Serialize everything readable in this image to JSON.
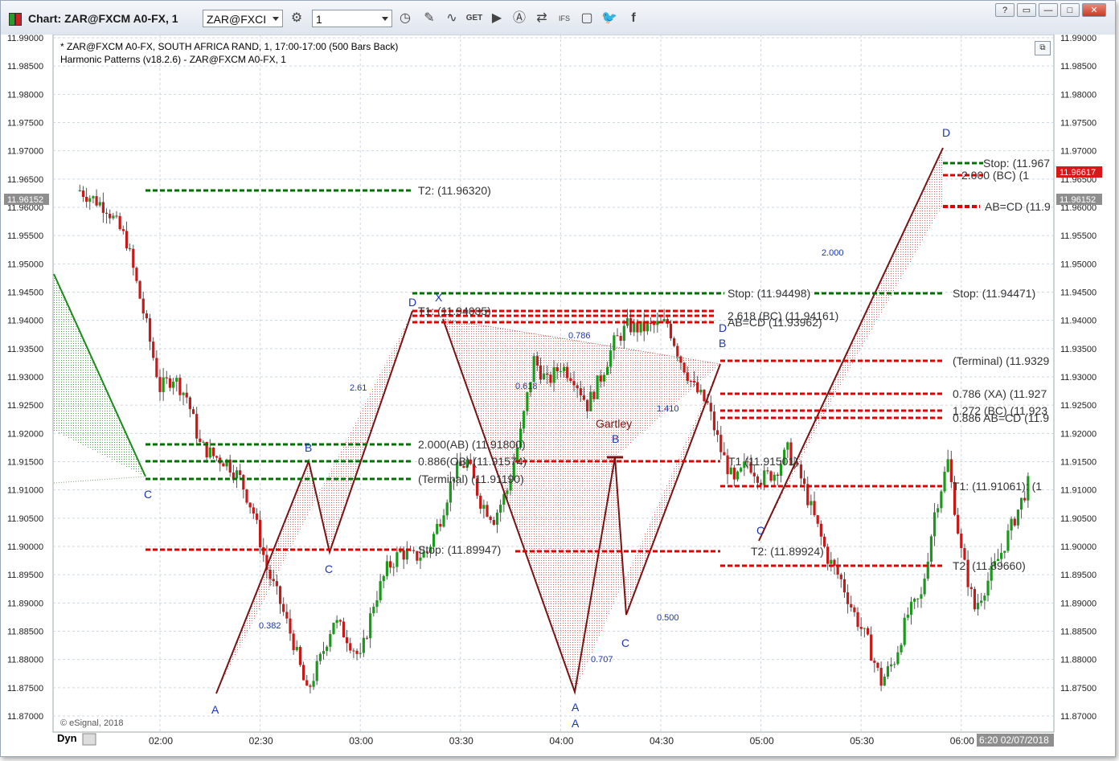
{
  "window": {
    "title": "Chart: ZAR@FXCM A0-FX, 1",
    "symbol_value": "ZAR@FXCI",
    "interval_value": "1",
    "buttons": {
      "help": "?",
      "restore": "▭",
      "minimize": "—",
      "maximize": "□",
      "close": "✕"
    }
  },
  "toolbar_icons": [
    "settings-icon",
    "clock-icon",
    "pencil-icon",
    "wave-icon",
    "get-icon",
    "play-icon",
    "alert-icon",
    "sync-icon",
    "ifs-icon",
    "comment-icon",
    "twitter-icon",
    "facebook-icon"
  ],
  "chart_header": {
    "line1": "* ZAR@FXCM A0-FX, SOUTH AFRICA RAND, 1, 17:00-17:00 (500 Bars Back)",
    "line2": "Harmonic Patterns (v18.2.6) - ZAR@FXCM A0-FX, 1"
  },
  "copyright": "© eSignal, 2018",
  "footer": {
    "dyn": "Dyn",
    "last_time": "6:20 02/07/2018"
  },
  "colors": {
    "bull": "#1a9a1a",
    "bear": "#c81818",
    "target_green": "#007000",
    "target_red": "#e00000",
    "pattern_line": "#7a1212",
    "pattern_label": "#1a36b0"
  },
  "chart_data": {
    "type": "candlestick",
    "y_axis": {
      "min": 11.865,
      "max": 11.995,
      "ticks": [
        "11.87000",
        "11.87500",
        "11.88000",
        "11.88500",
        "11.89000",
        "11.89500",
        "11.90000",
        "11.90500",
        "11.91000",
        "11.91500",
        "11.92000",
        "11.92500",
        "11.93000",
        "11.93500",
        "11.94000",
        "11.94500",
        "11.95000",
        "11.95500",
        "11.96000",
        "11.96500",
        "11.97000",
        "11.97500",
        "11.98000",
        "11.98500",
        "11.99000"
      ],
      "ref_price": "11.96152",
      "last_price": "11.96617"
    },
    "x_axis": {
      "ticks": [
        "02:00",
        "02:30",
        "03:00",
        "03:30",
        "04:00",
        "04:30",
        "05:00",
        "05:30",
        "06:00"
      ],
      "start_minutes": 96,
      "end_minutes": 380
    },
    "close_path": [
      [
        96,
        11.963
      ],
      [
        104,
        11.96
      ],
      [
        110,
        11.954
      ],
      [
        116,
        11.939
      ],
      [
        120,
        11.928
      ],
      [
        124,
        11.93
      ],
      [
        128,
        11.9265
      ],
      [
        132,
        11.918
      ],
      [
        136,
        11.916
      ],
      [
        140,
        11.915
      ],
      [
        144,
        11.912
      ],
      [
        148,
        11.906
      ],
      [
        152,
        11.896
      ],
      [
        156,
        11.89
      ],
      [
        160,
        11.883
      ],
      [
        164,
        11.874
      ],
      [
        168,
        11.88
      ],
      [
        172,
        11.887
      ],
      [
        176,
        11.884
      ],
      [
        180,
        11.88
      ],
      [
        184,
        11.89
      ],
      [
        188,
        11.896
      ],
      [
        192,
        11.899
      ],
      [
        196,
        11.898
      ],
      [
        200,
        11.899
      ],
      [
        204,
        11.905
      ],
      [
        208,
        11.913
      ],
      [
        212,
        11.915
      ],
      [
        216,
        11.908
      ],
      [
        220,
        11.905
      ],
      [
        224,
        11.91
      ],
      [
        228,
        11.92
      ],
      [
        232,
        11.933
      ],
      [
        236,
        11.929
      ],
      [
        240,
        11.932
      ],
      [
        244,
        11.93
      ],
      [
        248,
        11.925
      ],
      [
        252,
        11.93
      ],
      [
        256,
        11.936
      ],
      [
        260,
        11.939
      ],
      [
        264,
        11.9385
      ],
      [
        268,
        11.939
      ],
      [
        272,
        11.9395
      ],
      [
        276,
        11.933
      ],
      [
        280,
        11.928
      ],
      [
        284,
        11.925
      ],
      [
        288,
        11.917
      ],
      [
        292,
        11.911
      ],
      [
        296,
        11.915
      ],
      [
        300,
        11.912
      ],
      [
        304,
        11.913
      ],
      [
        308,
        11.917
      ],
      [
        312,
        11.912
      ],
      [
        316,
        11.905
      ],
      [
        320,
        11.898
      ],
      [
        324,
        11.894
      ],
      [
        328,
        11.888
      ],
      [
        332,
        11.883
      ],
      [
        336,
        11.876
      ],
      [
        340,
        11.88
      ],
      [
        344,
        11.888
      ],
      [
        348,
        11.891
      ],
      [
        352,
        11.906
      ],
      [
        356,
        11.915
      ],
      [
        360,
        11.899
      ],
      [
        364,
        11.889
      ],
      [
        368,
        11.894
      ],
      [
        372,
        11.899
      ],
      [
        376,
        11.905
      ],
      [
        380,
        11.911
      ]
    ],
    "candles_note": "generated",
    "annotations": [
      {
        "text": "T2: (11.96320)",
        "color": "green"
      },
      {
        "text": "T1: (11.94085)",
        "color": "red"
      },
      {
        "text": "Stop: (11.94498)",
        "color": "green"
      },
      {
        "text": "2.618 (BC) (11.94161)",
        "color": "red"
      },
      {
        "text": "AB=CD (11.93962)",
        "color": "red"
      },
      {
        "text": "2.000(AB) (11.91800)",
        "color": "green"
      },
      {
        "text": "0.886(OB) (11.91574)",
        "color": "green"
      },
      {
        "text": "(Terminal) (11.91190)",
        "color": "green"
      },
      {
        "text": "Stop: (11.89947)",
        "color": "red"
      },
      {
        "text": "T1 (11.91501)",
        "color": "red"
      },
      {
        "text": "T2: (11.89924)",
        "color": "red"
      },
      {
        "text": "Stop: (11.94471)",
        "color": "green"
      },
      {
        "text": "(Terminal) (11.9329",
        "color": "red"
      },
      {
        "text": "0.786 (XA) (11.927",
        "color": "red"
      },
      {
        "text": "1.272 (BC) (11.923",
        "color": "red"
      },
      {
        "text": "0.886 AB=CD (11.9",
        "color": "red"
      },
      {
        "text": "T1: (11.91061): (1",
        "color": "red"
      },
      {
        "text": "T2: (11.89660)",
        "color": "red"
      },
      {
        "text": "Stop: (11.967",
        "color": "green"
      },
      {
        "text": "2.000 (BC) (1",
        "color": "red"
      },
      {
        "text": "AB=CD (11.9",
        "color": "red"
      }
    ],
    "pattern_labels": [
      "A",
      "B",
      "C",
      "D",
      "X",
      "A",
      "B",
      "C",
      "D",
      "A",
      "B",
      "C",
      "D",
      "C",
      "Gartley"
    ],
    "ratio_labels": [
      "0.382",
      "2.61",
      "0.786",
      "0.618",
      "1.410",
      "0.707",
      "0.500",
      "2.000"
    ]
  }
}
